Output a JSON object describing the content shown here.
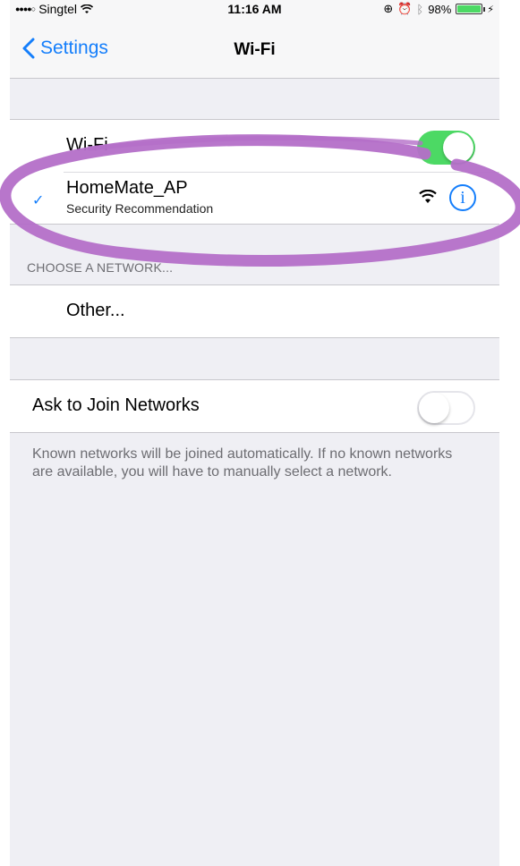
{
  "status_bar": {
    "signal_dots": "●●●●○",
    "carrier": "Singtel",
    "time": "11:16 AM",
    "battery_percent": "98%",
    "battery_level": 0.98,
    "icons": [
      "wifi-signal-icon",
      "orientation-lock-icon",
      "alarm-icon",
      "bluetooth-icon",
      "battery-icon",
      "charging-icon"
    ]
  },
  "nav": {
    "back_label": "Settings",
    "title": "Wi-Fi"
  },
  "wifi": {
    "label": "Wi-Fi",
    "enabled": true,
    "connected_network": {
      "name": "HomeMate_AP",
      "subtitle": "Security Recommendation"
    }
  },
  "choose_network": {
    "header": "CHOOSE A NETWORK...",
    "other_label": "Other..."
  },
  "ask_to_join": {
    "label": "Ask to Join Networks",
    "enabled": false,
    "footer": "Known networks will be joined automatically. If no known networks are available, you will have to manually select a network."
  },
  "colors": {
    "accent": "#147efb",
    "toggle_on": "#4cd964",
    "highlight_annotation": "#b46fc8",
    "background": "#efeff4"
  }
}
